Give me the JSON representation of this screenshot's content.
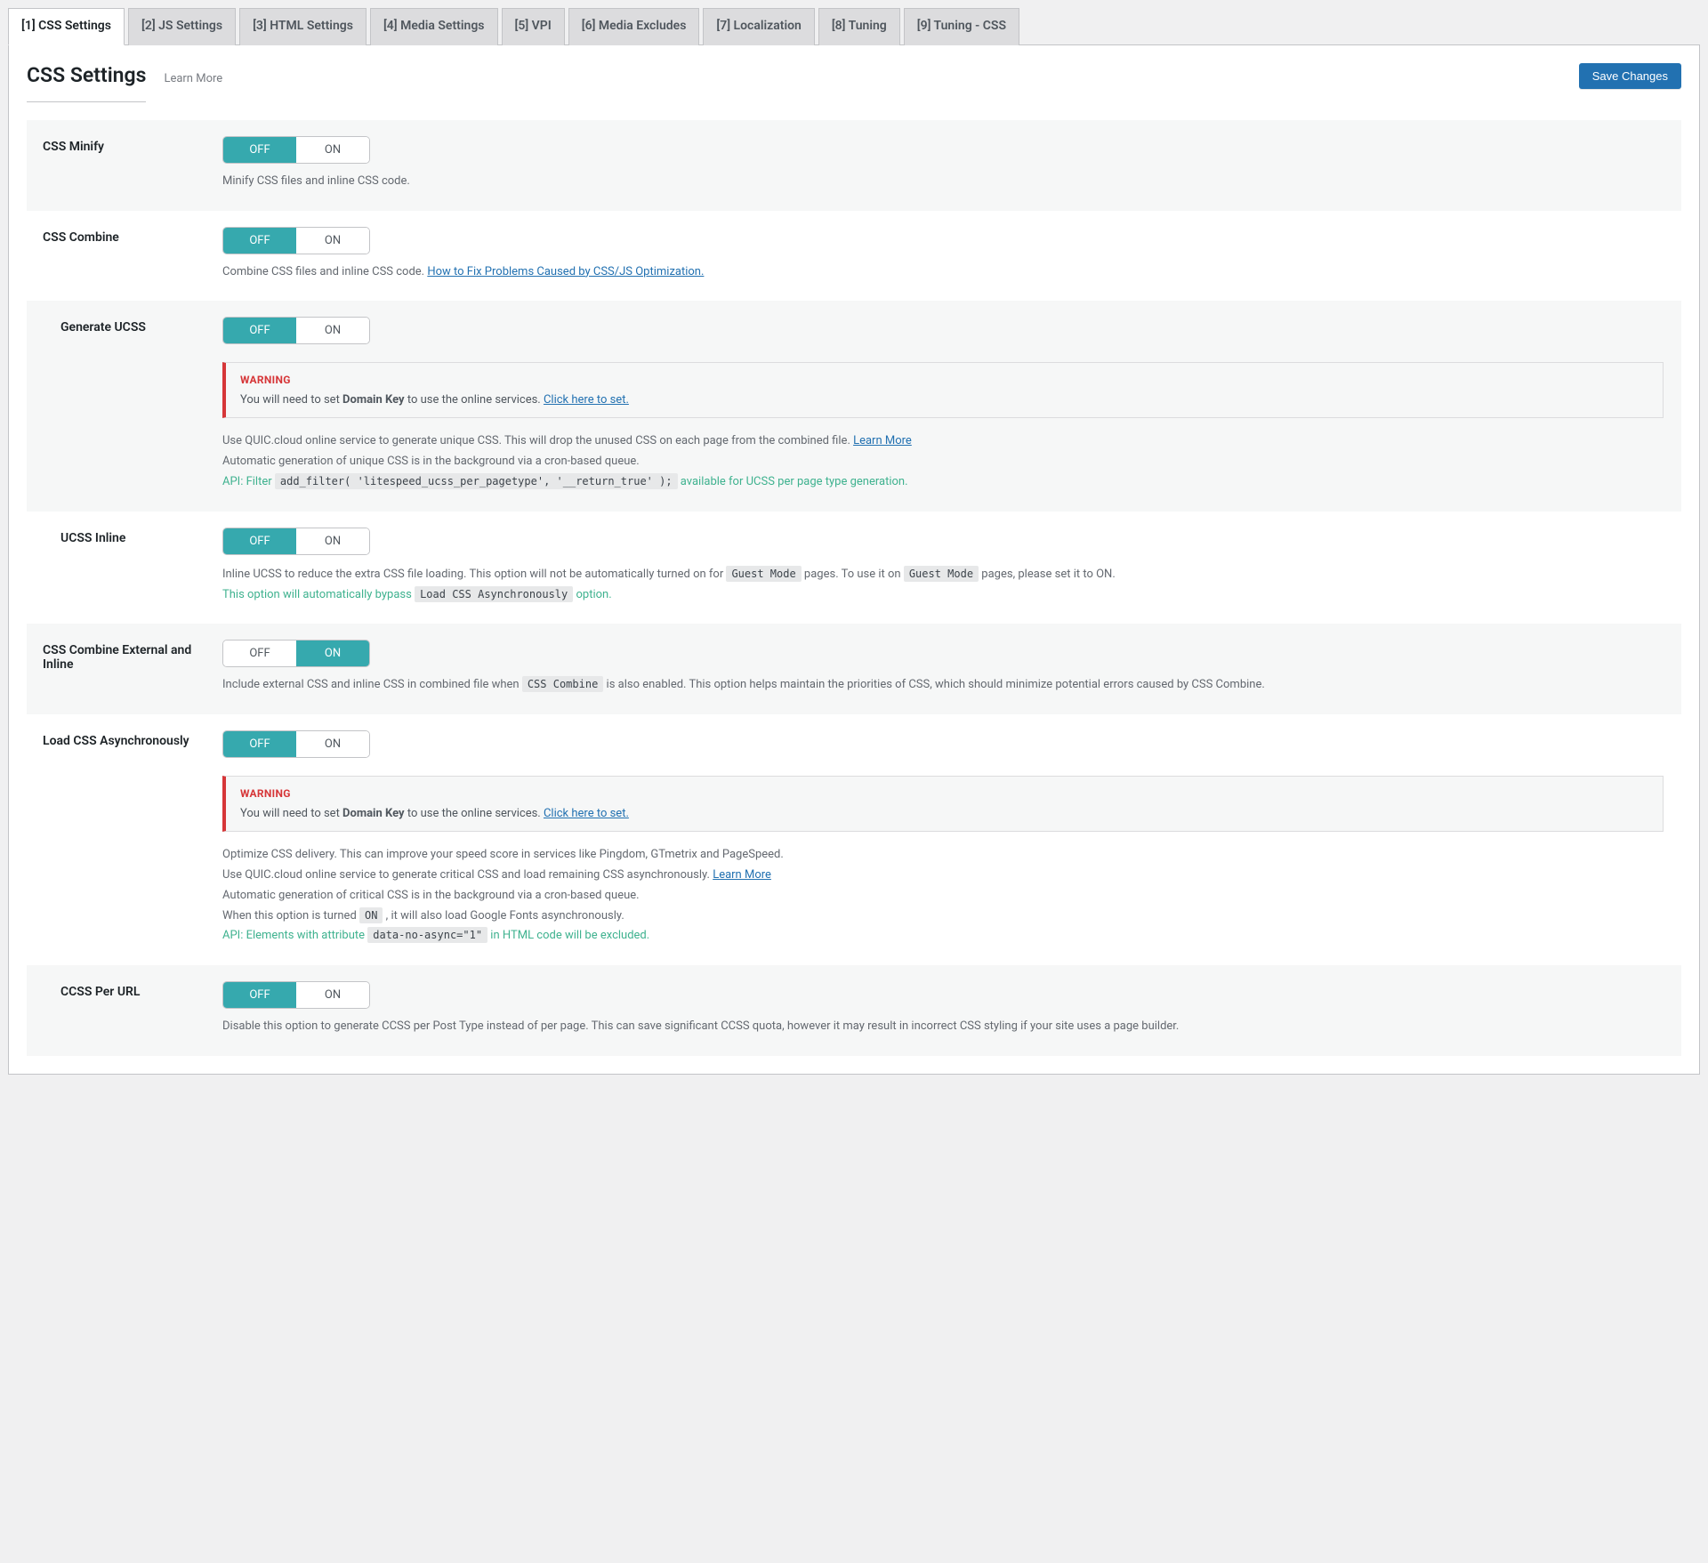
{
  "tabs": [
    {
      "label": "[1] CSS Settings",
      "active": true
    },
    {
      "label": "[2] JS Settings",
      "active": false
    },
    {
      "label": "[3] HTML Settings",
      "active": false
    },
    {
      "label": "[4] Media Settings",
      "active": false
    },
    {
      "label": "[5] VPI",
      "active": false
    },
    {
      "label": "[6] Media Excludes",
      "active": false
    },
    {
      "label": "[7] Localization",
      "active": false
    },
    {
      "label": "[8] Tuning",
      "active": false
    },
    {
      "label": "[9] Tuning - CSS",
      "active": false
    }
  ],
  "header": {
    "title": "CSS Settings",
    "learn_more": "Learn More",
    "save": "Save Changes"
  },
  "toggle": {
    "off": "OFF",
    "on": "ON"
  },
  "warning": {
    "title": "WARNING",
    "text_pre": "You will need to set ",
    "text_key": "Domain Key",
    "text_post": " to use the online services. ",
    "link": "Click here to set."
  },
  "rows": {
    "css_minify": {
      "label": "CSS Minify",
      "desc": "Minify CSS files and inline CSS code."
    },
    "css_combine": {
      "label": "CSS Combine",
      "desc": "Combine CSS files and inline CSS code. ",
      "link": "How to Fix Problems Caused by CSS/JS Optimization."
    },
    "generate_ucss": {
      "label": "Generate UCSS",
      "desc1": "Use QUIC.cloud online service to generate unique CSS. This will drop the unused CSS on each page from the combined file. ",
      "learn": "Learn More",
      "desc2": "Automatic generation of unique CSS is in the background via a cron-based queue.",
      "api_label": "API: Filter ",
      "api_code": "add_filter( 'litespeed_ucss_per_pagetype', '__return_true' );",
      "api_after": " available for UCSS per page type generation."
    },
    "ucss_inline": {
      "label": "UCSS Inline",
      "d1": "Inline UCSS to reduce the extra CSS file loading. This option will not be automatically turned on for ",
      "d2": " pages. To use it on ",
      "d3": " pages, please set it to ON.",
      "guest": "Guest Mode",
      "bypass1": "This option will automatically bypass ",
      "bypass_code": "Load CSS Asynchronously",
      "bypass2": " option."
    },
    "css_combine_ext": {
      "label": "CSS Combine External and Inline",
      "d1": "Include external CSS and inline CSS in combined file when ",
      "code": "CSS Combine",
      "d2": " is also enabled. This option helps maintain the priorities of CSS, which should minimize potential errors caused by CSS Combine."
    },
    "load_async": {
      "label": "Load CSS Asynchronously",
      "d1": "Optimize CSS delivery. This can improve your speed score in services like Pingdom, GTmetrix and PageSpeed.",
      "d2": "Use QUIC.cloud online service to generate critical CSS and load remaining CSS asynchronously. ",
      "learn": "Learn More",
      "d3": "Automatic generation of critical CSS is in the background via a cron-based queue.",
      "d4a": "When this option is turned ",
      "d4code": "ON",
      "d4b": " , it will also load Google Fonts asynchronously.",
      "api1": "API: Elements with attribute ",
      "api_code": "data-no-async=\"1\"",
      "api2": " in HTML code will be excluded."
    },
    "ccss_per_url": {
      "label": "CCSS Per URL",
      "desc": "Disable this option to generate CCSS per Post Type instead of per page. This can save significant CCSS quota, however it may result in incorrect CSS styling if your site uses a page builder."
    }
  }
}
